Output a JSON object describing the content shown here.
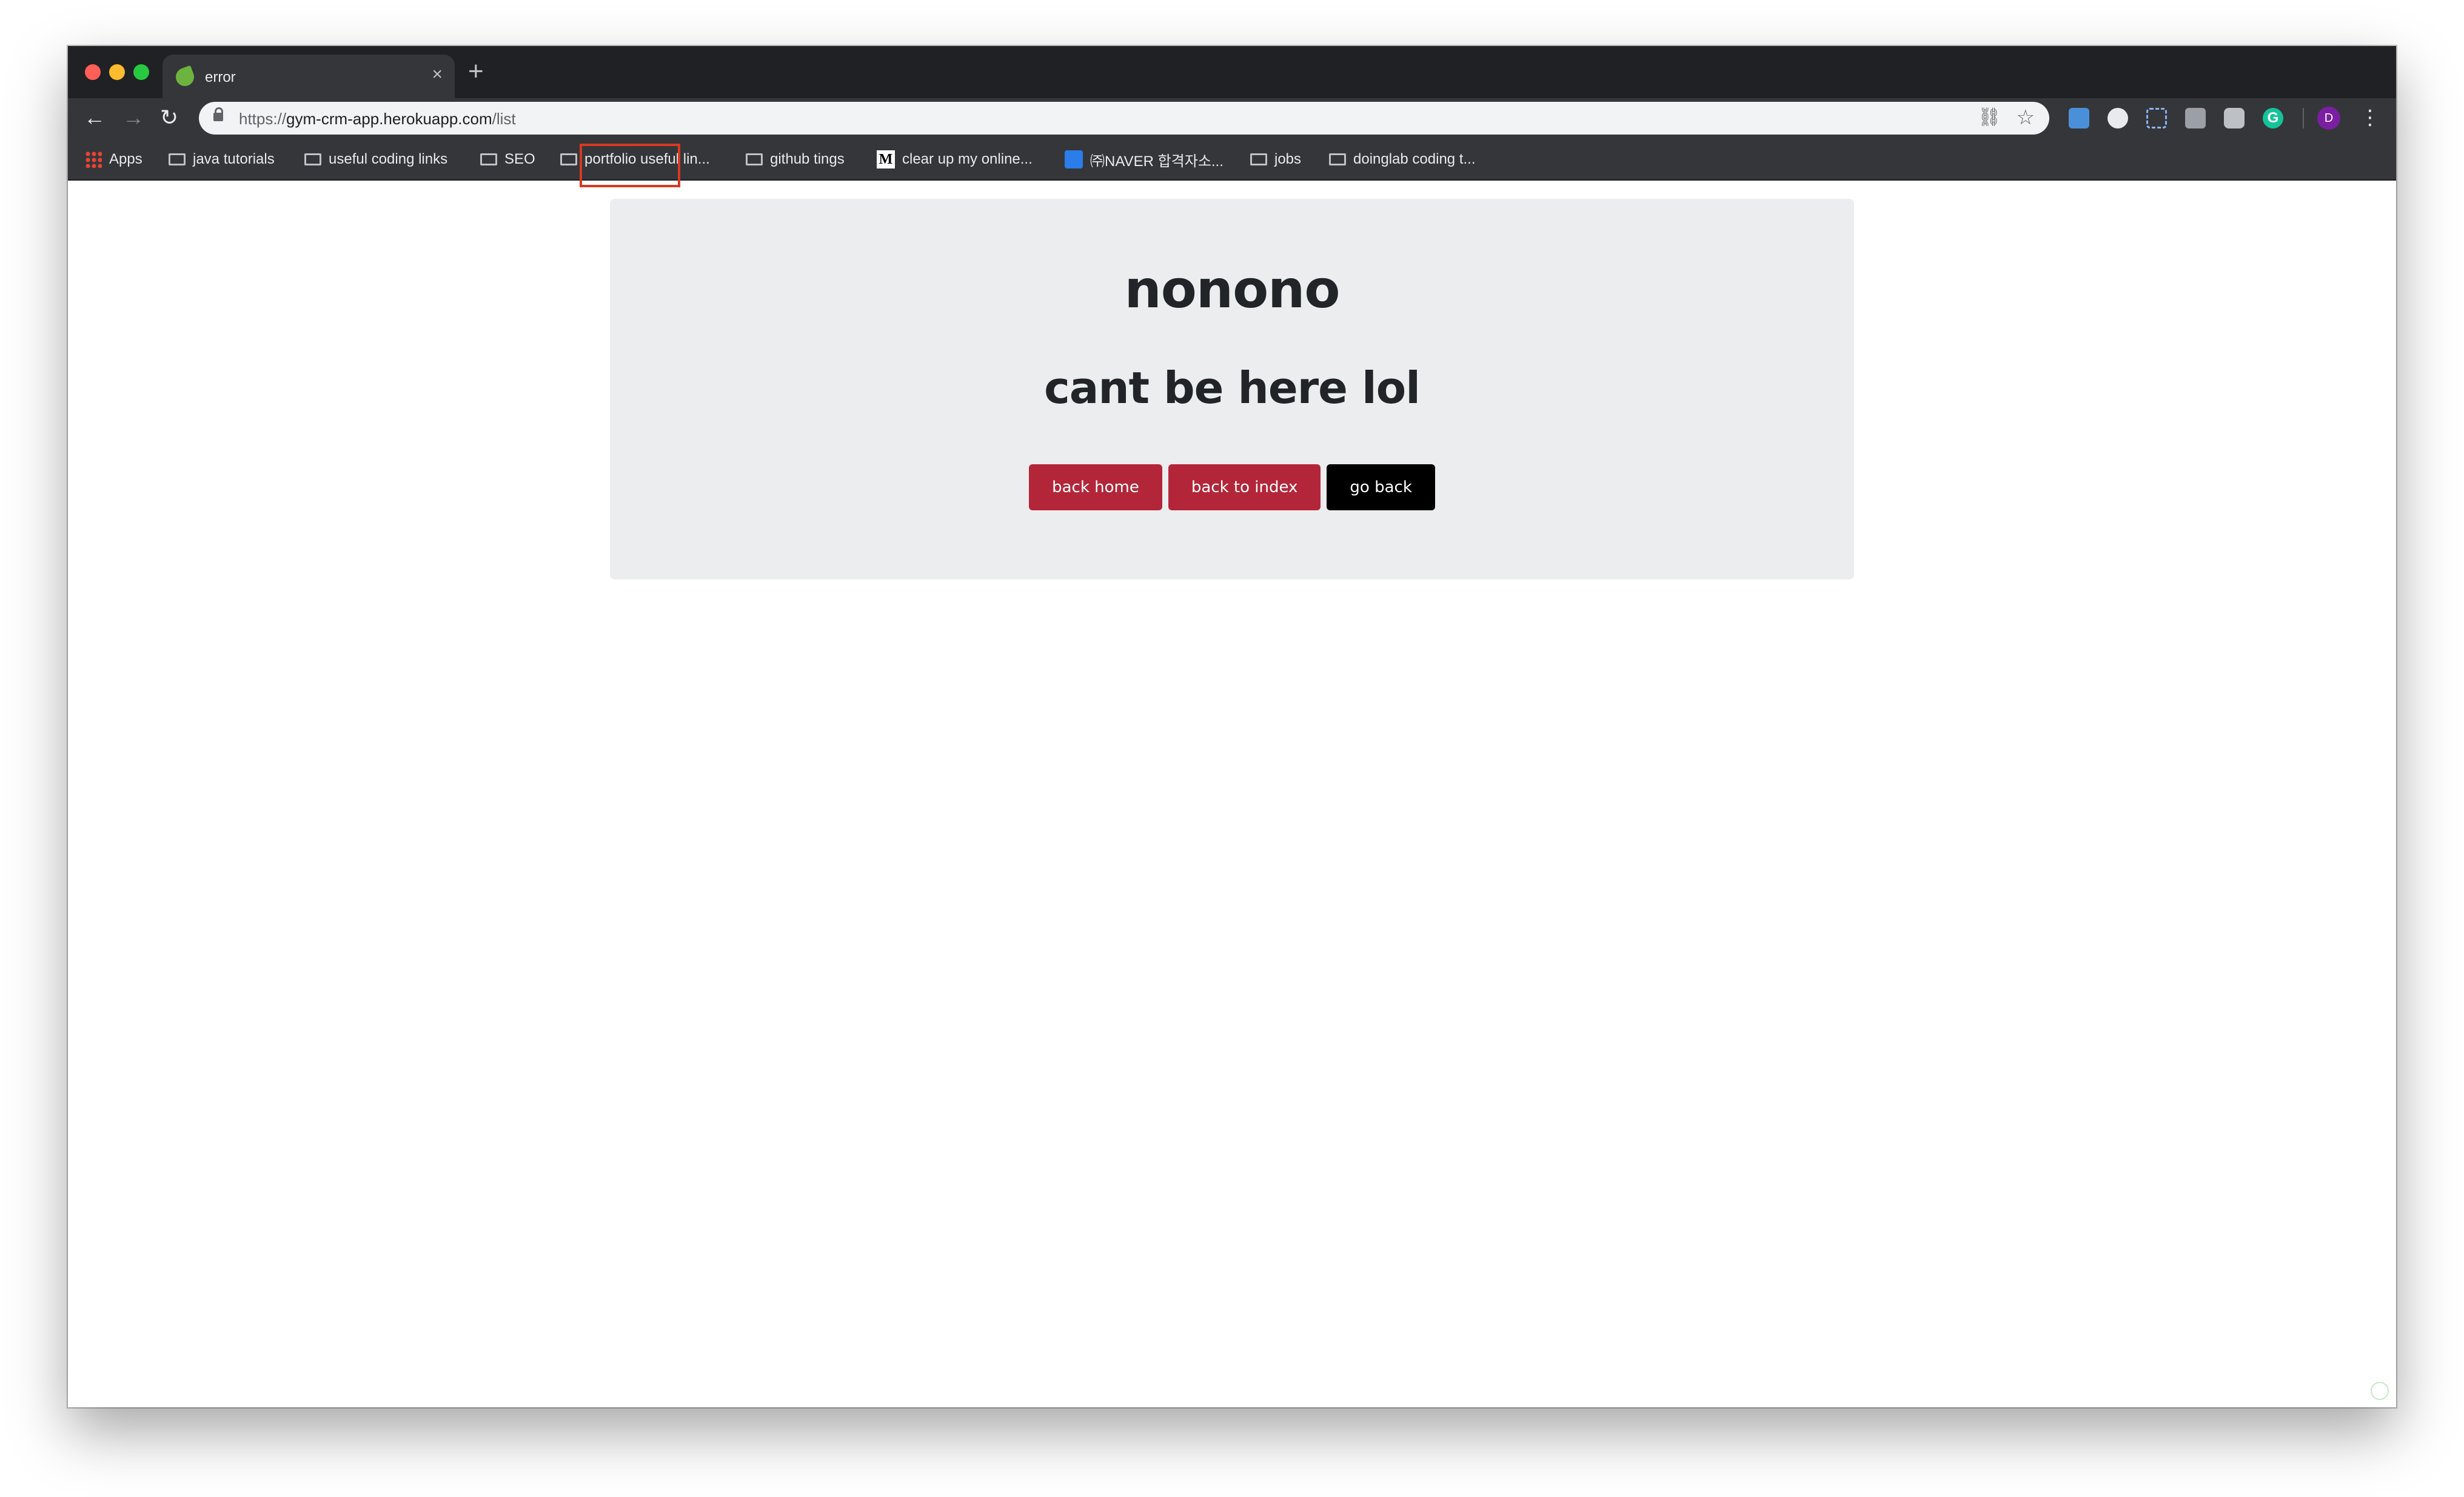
{
  "browser": {
    "tab_title": "error",
    "new_tab_glyph": "+",
    "close_glyph": "×",
    "url_scheme": "https://",
    "url_host": "gym-crm-app.herokuapp.com",
    "url_path": "/list",
    "profile_initial": "D",
    "extensions": [
      "calendar-ext-icon",
      "circle-ext-icon",
      "screenshot-ext-icon",
      "ext-icon",
      "camera-ext-icon",
      "grammarly-icon"
    ],
    "grammarly_letter": "G"
  },
  "bookmarks": {
    "items": [
      {
        "label": "Apps",
        "icon": "apps-grid-icon"
      },
      {
        "label": "java tutorials",
        "icon": "folder-icon"
      },
      {
        "label": "useful coding links",
        "icon": "folder-icon"
      },
      {
        "label": "SEO",
        "icon": "folder-icon"
      },
      {
        "label": "portfolio useful lin...",
        "icon": "folder-icon"
      },
      {
        "label": "github tings",
        "icon": "folder-icon"
      },
      {
        "label": "clear up my online...",
        "icon": "medium-icon"
      },
      {
        "label": "㈜NAVER 합격자소...",
        "icon": "naver-icon"
      },
      {
        "label": "jobs",
        "icon": "folder-icon"
      },
      {
        "label": "doinglab coding t...",
        "icon": "folder-icon"
      }
    ],
    "medium_letter": "M"
  },
  "page": {
    "headline": "nonono",
    "subhead": "cant be here lol",
    "buttons": {
      "back_home": "back home",
      "back_to_index": "back to index",
      "go_back": "go back"
    }
  },
  "colors": {
    "danger": "#b3263a",
    "dark": "#000000",
    "jumbotron_bg": "#ecedee",
    "highlight": "#d63a22"
  }
}
